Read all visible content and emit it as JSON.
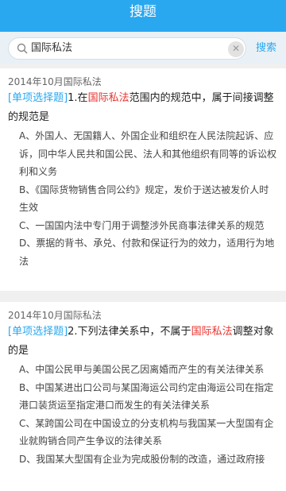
{
  "header": {
    "title": "搜题"
  },
  "search": {
    "query": "国际私法",
    "search_label": "搜索",
    "clear_icon": "close-icon"
  },
  "questions": [
    {
      "meta": "2014年10月国际私法",
      "tag": "[单项选择题]",
      "stem_pre": "1.在",
      "keyword": "国际私法",
      "stem_post": "范围内的规范中，属于间接调整的规范是",
      "options": [
        "A、外国人、无国籍人、外国企业和组织在人民法院起诉、应诉，同中华人民共和国公民、法人和其他组织有同等的诉讼权利和义务",
        "B、《国际货物销售合同公约》规定，发价于送达被发价人时生效",
        "C、一国国内法中专门用于调整涉外民商事法律关系的规范",
        "D、票据的背书、承兑、付款和保证行为的效力，适用行为地法"
      ]
    },
    {
      "meta": "2014年10月国际私法",
      "tag": "[单项选择题]",
      "stem_pre": "2.下列法律关系中，不属于",
      "keyword": "国际私法",
      "stem_post": "调整对象的是",
      "options": [
        "A、中国公民甲与美国公民乙因离婚而产生的有关法律关系",
        "B、中国某进出口公司与某国海运公司约定由海运公司在指定港口装货运至指定港口而发生的有关法律关系",
        "C、某跨国公司在中国设立的分支机构与我国某一大型国有企业就购销合同产生争议的法律关系",
        "D、我国某大型国有企业为完成股份制的改造，通过政府接"
      ]
    }
  ],
  "colors": {
    "header_bg": "#29a8f0",
    "accent": "#29a8f0",
    "keyword": "#e8322d"
  }
}
